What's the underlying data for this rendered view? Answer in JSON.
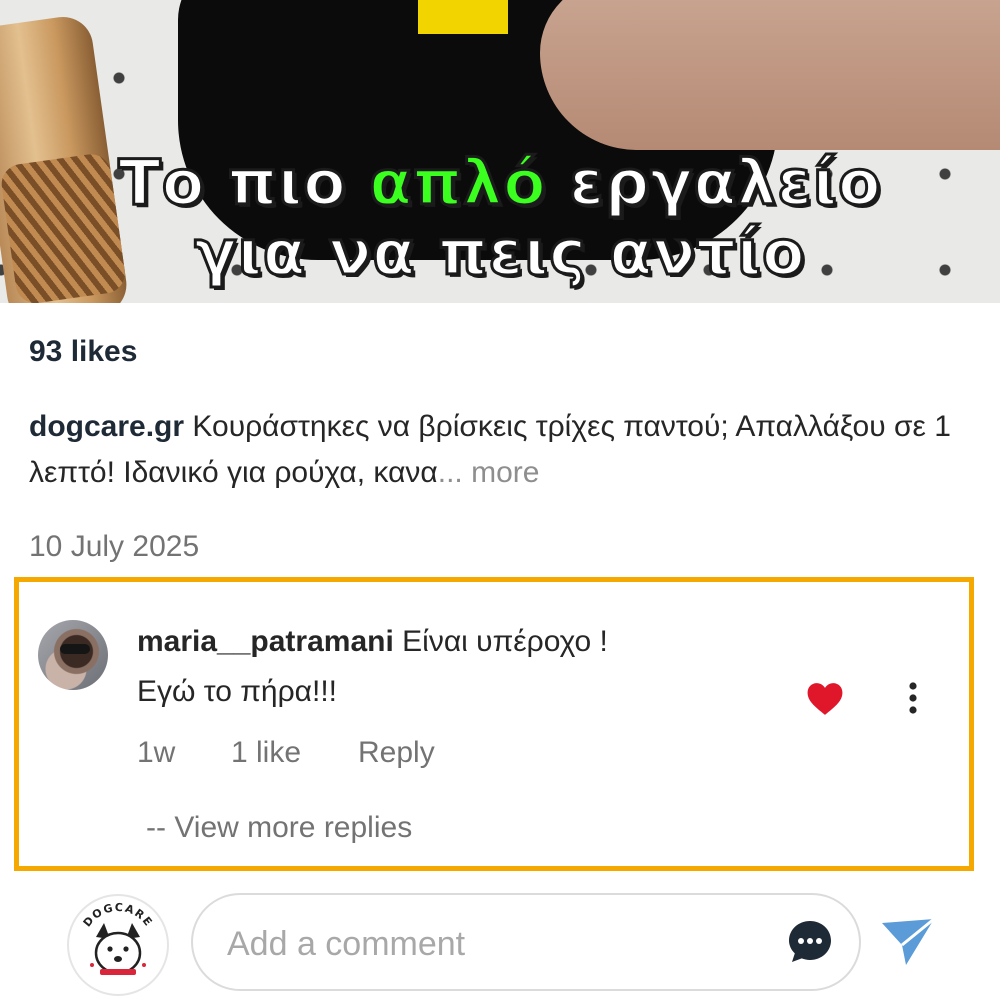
{
  "media": {
    "caption_line1_pre": "Το πιο ",
    "caption_line1_highlight": "απλό",
    "caption_line1_post": " εργαλείο",
    "caption_line2": "για να πεις αντίο"
  },
  "post": {
    "likes": "93 likes",
    "username": "dogcare.gr",
    "caption": " Κουράστηκες να βρίσκεις τρίχες παντού; Απαλλάξου σε 1 λεπτό! Ιδανικό για ρούχα, κανα",
    "more": "... more",
    "date": "10 July 2025"
  },
  "comment": {
    "username": "maria__patramani",
    "text_line1": " Είναι υπέροχο !",
    "text_line2": "Εγώ το πήρα!!!",
    "time": "1w",
    "likes": "1 like",
    "reply": "Reply",
    "view_replies": "-- View more replies",
    "liked": true
  },
  "composer": {
    "placeholder": "Add a comment",
    "avatar_logo_text": "DOGCARE"
  },
  "colors": {
    "highlight_border": "#f5a800",
    "heart": "#e0162b",
    "send": "#5a9bd8",
    "caption_highlight": "#3aff1f"
  },
  "icons": [
    "heart-icon",
    "more-options-icon",
    "chat-bubble-icon",
    "send-icon"
  ]
}
